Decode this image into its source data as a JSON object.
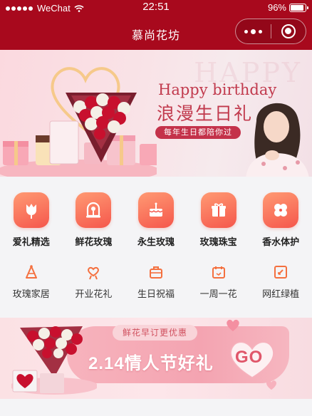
{
  "status_bar": {
    "carrier": "WeChat",
    "time": "22:51",
    "battery": "96%",
    "battery_level": 0.96
  },
  "nav": {
    "title": "慕尚花坊"
  },
  "hero_banner": {
    "ghost_text": "HAPPY",
    "title": "Happy birthday",
    "subtitle": "浪漫生日礼",
    "tagline": "每年生日都陪你过"
  },
  "categories": [
    {
      "label": "爱礼精选",
      "icon": "tulip-icon"
    },
    {
      "label": "鲜花玫瑰",
      "icon": "rose-dome-icon"
    },
    {
      "label": "永生玫瑰",
      "icon": "cake-icon"
    },
    {
      "label": "玫瑰珠宝",
      "icon": "gift-box-icon"
    },
    {
      "label": "香水体护",
      "icon": "clover-icon"
    }
  ],
  "sub_categories": [
    {
      "label": "玫瑰家居",
      "icon": "party-hat-icon"
    },
    {
      "label": "开业花礼",
      "icon": "heart-ribbon-icon"
    },
    {
      "label": "生日祝福",
      "icon": "briefcase-icon"
    },
    {
      "label": "一周一花",
      "icon": "calendar-icon"
    },
    {
      "label": "网红绿植",
      "icon": "edit-box-icon"
    }
  ],
  "promo_banner": {
    "tag": "鲜花早订更优惠",
    "title": "2.14情人节好礼",
    "cta": "GO"
  },
  "colors": {
    "brand": "#a8091d",
    "accent": "#f5574c",
    "pink": "#c13a4d"
  }
}
